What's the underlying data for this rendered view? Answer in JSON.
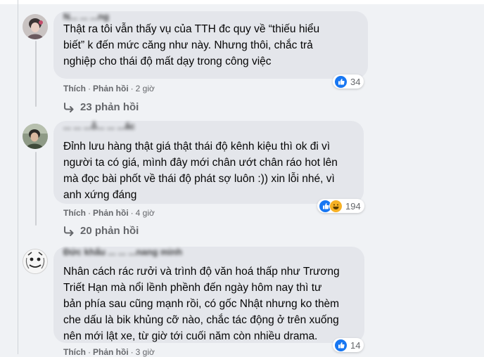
{
  "comments": [
    {
      "author": "N... ... ...ng",
      "text": "Thật ra tôi vẫn thấy vụ của TTH đc quy về “thiếu hiểu\nbiết” k đến mức căng như này. Nhưng thôi, chắc trả\nnghiệp cho thái độ mất dạy trong công việc",
      "like_label": "Thích",
      "reply_label": "Phản hồi",
      "time": "2 giờ",
      "reaction_count": "34",
      "reactions": [
        "like-icon"
      ],
      "replies_label": "23 phản hồi"
    },
    {
      "author": "... ... ...ỗ... ... ...ấc",
      "text": "Đỉnh lưu hàng thật giá thật thái độ kênh kiệu thì ok đi vì\nngười ta có giá, mình đây mới chân ướt chân ráo hot lên\nmà đọc bài phốt về thái độ phát sợ luôn :)) xin lỗi nhé, vì\nanh xứng đáng",
      "like_label": "Thích",
      "reply_label": "Phản hồi",
      "time": "4 giờ",
      "reaction_count": "194",
      "reactions": [
        "like-icon",
        "haha-icon"
      ],
      "replies_label": "20 phản hồi"
    },
    {
      "author": "Đức khẩu ... ... ...nang minh",
      "text": "Nhân cách rác rưởi và trình độ văn hoá thấp như Trương\nTriết Hạn mà nổi lềnh phềnh đến ngày hôm nay thì tư\nbản phía sau cũng mạnh rồi, có gốc Nhật nhưng ko thèm\nche dấu là bik khủng cỡ nào, chắc tác động ở trên xuống\nnên mới lật xe, từ giờ tới cuối năm còn nhiều drama.",
      "like_label": "Thích",
      "reply_label": "Phản hồi",
      "time": "3 giờ",
      "reaction_count": "14",
      "reactions": [
        "like-icon"
      ]
    }
  ],
  "colors": {
    "page_bg": "#f0f2f5",
    "bubble_bg": "#e4e6eb",
    "meta_text": "#65676b",
    "like_blue": "#1877f2",
    "haha_yellow": "#f7b125"
  }
}
